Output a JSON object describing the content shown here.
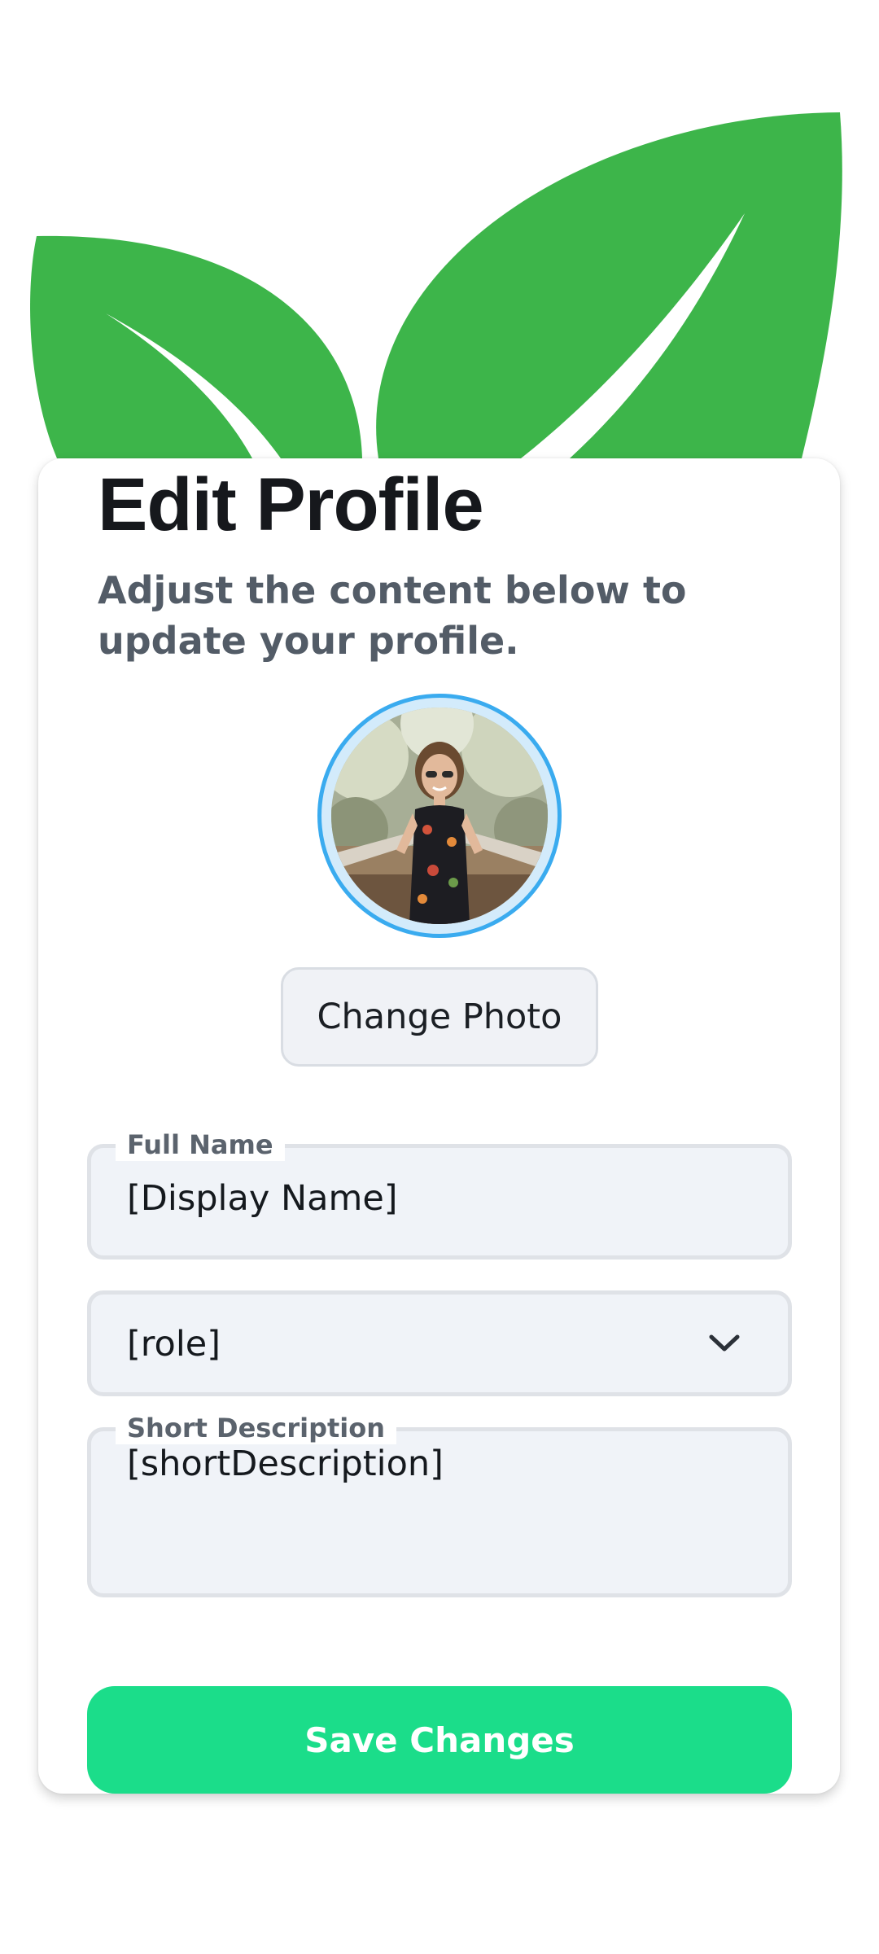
{
  "header": {
    "title": "Edit Profile",
    "subtitle": "Adjust the content below to update your profile.",
    "decoration_icon": "leaves-icon",
    "decoration_color": "#3db54a"
  },
  "profile": {
    "avatar_icon": "profile-photo",
    "avatar_ring_color": "#3aabef",
    "change_photo_label": "Change Photo"
  },
  "form": {
    "full_name": {
      "label": "Full Name",
      "value": "[Display Name]"
    },
    "role": {
      "value": "[role]",
      "icon": "chevron-down-icon"
    },
    "short_description": {
      "label": "Short Description",
      "value": "[shortDescription]"
    }
  },
  "actions": {
    "save_label": "Save Changes",
    "save_color": "#1bdd8a"
  }
}
